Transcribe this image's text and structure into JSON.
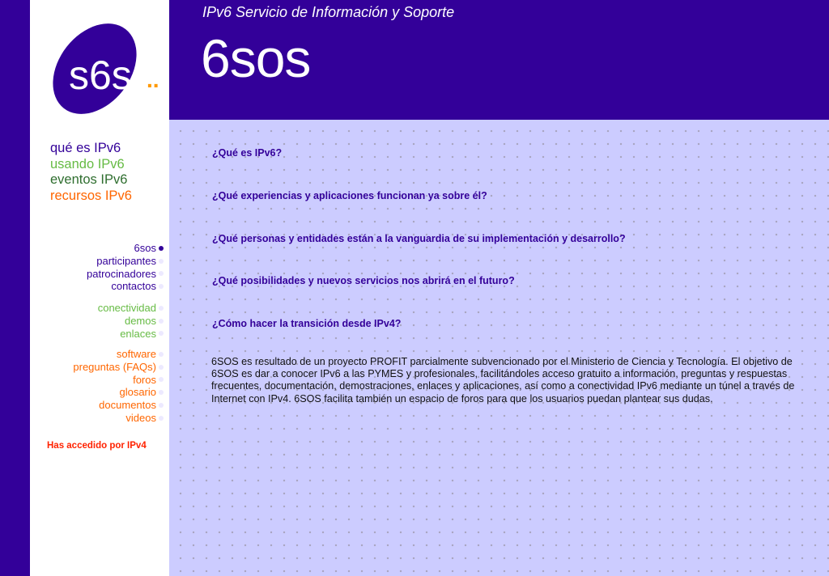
{
  "header": {
    "subtitle": "IPv6 Servicio de Información y Soporte",
    "title": "6sos"
  },
  "logo": {
    "text": "s6s",
    "dots": ".."
  },
  "colors": {
    "brand": "#330099",
    "light_bg": "#ccccff",
    "green": "#66bb44",
    "orange": "#ff6600",
    "alert": "#ff2200"
  },
  "primary_nav": [
    {
      "label": "qué es IPv6",
      "color": "#330099"
    },
    {
      "label": "usando IPv6",
      "color": "#66bb44"
    },
    {
      "label": "eventos IPv6",
      "color": "#2f6e2f"
    },
    {
      "label": "recursos IPv6",
      "color": "#ff6600"
    }
  ],
  "nav_groups": [
    {
      "items": [
        "6sos",
        "participantes",
        "patrocinadores",
        "contactos"
      ]
    },
    {
      "items": [
        "conectividad",
        "demos",
        "enlaces"
      ]
    },
    {
      "items": [
        "software",
        "preguntas (FAQs)",
        "foros",
        "glosario",
        "documentos",
        "videos"
      ]
    }
  ],
  "status_text": "Has accedido por IPv4",
  "questions": [
    "¿Qué es IPv6?",
    "¿Qué experiencias y aplicaciones funcionan ya sobre él?",
    "¿Qué personas y entidades están a la vanguardia de su implementación y desarrollo?",
    "¿Qué posibilidades y nuevos servicios nos abrirá en el futuro?",
    "¿Cómo hacer la transición desde IPv4?"
  ],
  "description": "6SOS es resultado de un proyecto PROFIT parcialmente subvencionado por el Ministerio de Ciencia y Tecnología. El objetivo de 6SOS es dar a conocer IPv6 a las PYMES y profesionales, facilitándoles acceso gratuito a información, preguntas y respuestas frecuentes, documentación, demostraciones, enlaces y aplicaciones, así como a conectividad IPv6 mediante un túnel a través de Internet con IPv4. 6SOS facilita también un espacio de foros para que los usuarios puedan plantear sus dudas."
}
